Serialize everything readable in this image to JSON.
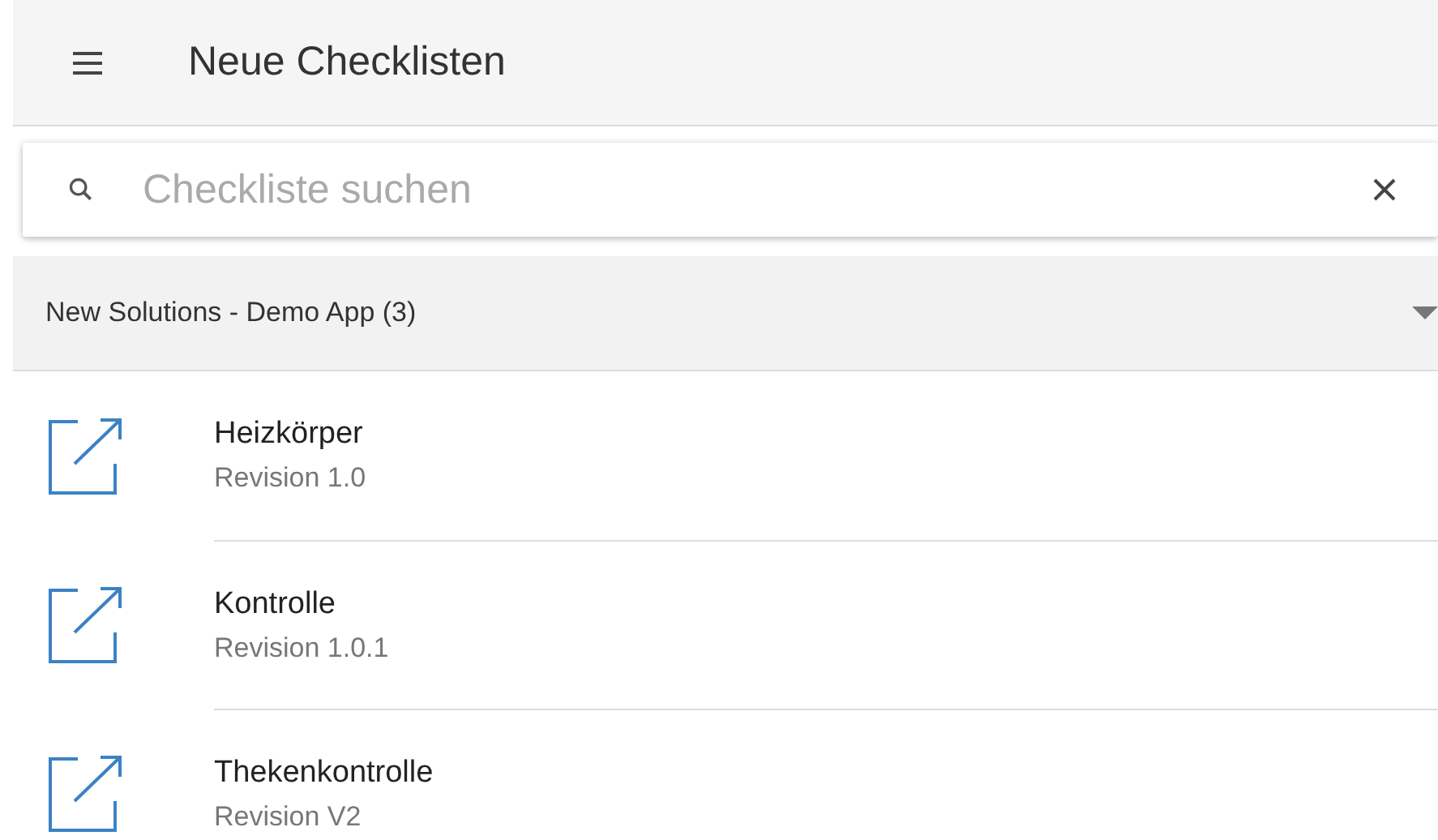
{
  "toolbar": {
    "title": "Neue Checklisten"
  },
  "search": {
    "placeholder": "Checkliste suchen"
  },
  "group": {
    "label": "New Solutions - Demo App (3)"
  },
  "items": [
    {
      "title": "Heizkörper",
      "subtitle": "Revision 1.0"
    },
    {
      "title": "Kontrolle",
      "subtitle": "Revision 1.0.1"
    },
    {
      "title": "Thekenkontrolle",
      "subtitle": "Revision V2"
    }
  ]
}
